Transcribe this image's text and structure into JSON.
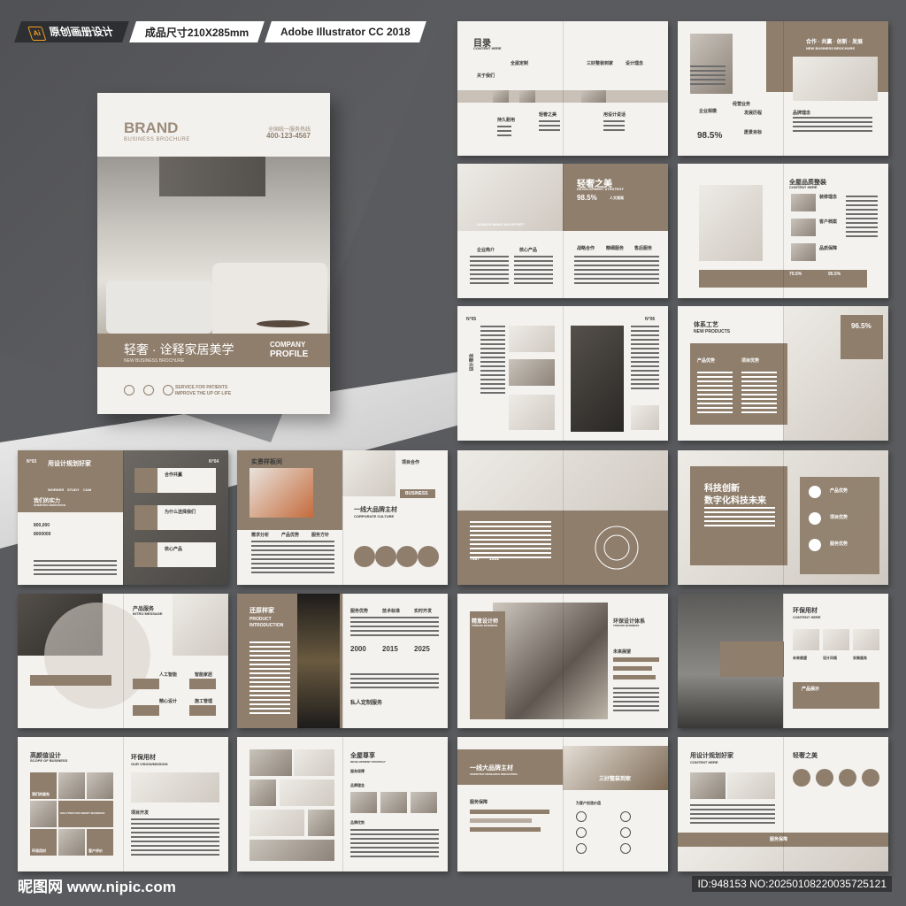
{
  "header": {
    "tag1": "原创画册设计",
    "tag1_icon": "Ai",
    "tag2": "成品尺寸210X285mm",
    "tag3": "Adobe Illustrator CC 2018"
  },
  "cover": {
    "brand": "BRAND",
    "brand_sub": "BUSINESS BROCHURE",
    "hotline": "全国统一服务热线",
    "phone": "400-123-4567",
    "title_cn": "轻奢 · 诠释家居美学",
    "title_en": "NEW BUSINESS BROCHURE",
    "company": "COMPANY",
    "profile": "PROFILE",
    "service": "SERVICE FOR PATIENTS",
    "service2": "IMPROVE THE UP OF LIFE"
  },
  "spreads": {
    "s1": {
      "title": "目录",
      "sub": "CONTENT HERE",
      "items": [
        "关于我们",
        "全屋定制",
        "三好整装到家",
        "设计理念",
        "服务介绍",
        "用设计说话",
        "持久耐用",
        "轻奢之美",
        "中式风格"
      ]
    },
    "s2": {
      "title": "合作 · 共赢 · 创新 · 发展",
      "sub": "NEW BUSINESS BROCHURE",
      "pct": "98.5%",
      "a": "企业规模",
      "b": "经营业务",
      "c": "品牌理念",
      "d": "发展历程",
      "e": "愿景目标"
    },
    "s3": {
      "tagline": "ALWAYS MAKE AN EFFORT",
      "title": "轻奢之美",
      "sub": "DEVELOPMENT STRATEGY",
      "pct": "98.5%",
      "pct_label": "人文格局",
      "a": "企业简介",
      "b": "核心产品",
      "c": "战略合作",
      "d": "精细服务",
      "e": "售后服务"
    },
    "s4": {
      "title": "全屋品质整装",
      "sub": "CONTENT HERE",
      "a": "装修理念",
      "b": "客户档案",
      "c": "品质保障",
      "p1": "70.5%",
      "p2": "95.5%"
    },
    "s5": {
      "no1": "N°05",
      "no2": "N°06",
      "side": "设计理念"
    },
    "s6": {
      "title": "体系工艺",
      "sub": "NEW PRODUCTS",
      "pct": "96.5%",
      "a": "产品优势",
      "b": "项目优势"
    },
    "s7": {
      "no1": "N°03",
      "no2": "N°04",
      "title": "用设计规划好家",
      "a": "WORKER",
      "b": "STUDY",
      "c": "CAM",
      "d": "我们的实力",
      "e": "SCIENTIFIC INNOVATION",
      "f": "800,000",
      "g": "8000000",
      "h": "合作共赢",
      "i": "为什么选择我们",
      "j": "核心产品"
    },
    "s8": {
      "title": "实景样板间",
      "sub": "OUR STRENGTHS",
      "a": "项目合作",
      "b": "BUSINESS",
      "c": "一线大品牌主材",
      "d": "CORPORATE CULTURE",
      "e": "需求分析",
      "f": "产品优势",
      "g": "服务方针"
    },
    "s9": {
      "a": "7687",
      "b": "1932"
    },
    "s10": {
      "title1": "科技创新",
      "title2": "数字化科技未来",
      "a": "产品优势",
      "b": "项目优势",
      "c": "服务优势"
    },
    "s11": {
      "title": "产品服务",
      "sub": "INTRO MESSAGE",
      "a": "人工智能",
      "b": "智能家居",
      "c": "精心设计",
      "d": "施工管理"
    },
    "s12": {
      "title": "还原样家",
      "sub1": "PRODUCT",
      "sub2": "INTRODUCTION",
      "a": "服务优势",
      "b": "技术标准",
      "c": "实时开发",
      "y1": "2000",
      "y2": "2015",
      "y3": "2025",
      "d": "私人定制服务"
    },
    "s13": {
      "title": "精意设计师",
      "sub": "TONGRO BUSINESS",
      "right": "环保设计体系",
      "right_sub": "TONGRO BUSINESS",
      "a": "未来展望"
    },
    "s14": {
      "title": "环保用材",
      "sub": "CONTENT HERE",
      "a": "未来展望",
      "b": "设计风格",
      "c": "安装服务",
      "d": "产品展示"
    },
    "s15": {
      "title": "高颜值设计",
      "sub": "SCOPE OF BUSINESS",
      "a": "环保用材",
      "b": "OUR VISION/MISSION",
      "c": "我们的服务",
      "d": "SOLUTION FOR SMART BUSINESS",
      "e": "环保用材",
      "f": "客户评价",
      "g": "项目开发"
    },
    "s16": {
      "title": "全屋尊享",
      "sub": "DEVELOPMENT STRATEGY",
      "a": "服务保障",
      "b": "品牌理念",
      "c": "品牌优势"
    },
    "s17": {
      "title": "一线大品牌主材",
      "sub": "SCIENTIFIC RESEARCH INNOVATION",
      "tag": "三好整装到家",
      "tag_sub": "OUR STRENGTHS",
      "a": "服务保障",
      "b": "为客户创造价值",
      "c": "服务保障",
      "d": "服务保障"
    },
    "s18": {
      "title": "用设计规划好家",
      "sub": "CONTENT HERE",
      "right": "轻奢之美",
      "a": "服务保障"
    }
  },
  "footer": {
    "watermark": "昵图网 www.nipic.com",
    "id": "ID:948153 NO:20250108220035725121"
  }
}
